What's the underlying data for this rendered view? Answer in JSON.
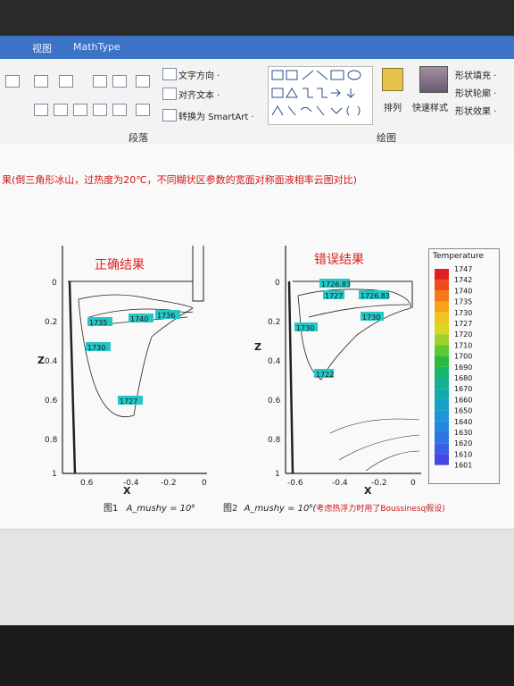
{
  "ribbon": {
    "tabs": [
      "视图",
      "MathType"
    ],
    "paragraph_group_label": "段落",
    "drawing_group_label": "绘图",
    "text_direction": "文字方向 ·",
    "align_text": "对齐文本 ·",
    "convert_smartart": "转换为 SmartArt ·",
    "arrange": "排列",
    "quick_styles": "快速样式",
    "shape_fill": "形状填充 ·",
    "shape_outline": "形状轮廓 ·",
    "shape_effects": "形状效果 ·"
  },
  "document": {
    "caption": "果(倒三角形冰山，过热度为20℃，不同糊状区参数的宽面对称面液相率云图对比)",
    "left_panel": {
      "title": "正确结果",
      "figure_label": "图1",
      "formula": "A_mushy = 10⁶",
      "contour_labels": [
        "1735",
        "1740",
        "1736",
        "1730",
        "1727"
      ]
    },
    "right_panel": {
      "title": "错误结果",
      "figure_label": "图2",
      "formula": "A_mushy = 10⁶(",
      "figure_note": "考虑热浮力时用了Boussinesq假设)",
      "contour_labels": [
        "1726.83",
        "1727",
        "1726.83",
        "1730",
        "1730",
        "1722"
      ]
    },
    "axis": {
      "z_label": "Z",
      "x_label": "X",
      "z_ticks": [
        "0",
        "0.2",
        "0.4",
        "0.6",
        "0.8",
        "1"
      ],
      "x_ticks_left": [
        "0.6",
        "-0.4",
        "-0.2",
        "0"
      ],
      "x_ticks_right": [
        "-0.6",
        "-0.4",
        "-0.2",
        "0"
      ]
    }
  },
  "legend": {
    "title": "Temperature",
    "levels": [
      "1747",
      "1742",
      "1740",
      "1735",
      "1730",
      "1727",
      "1720",
      "1710",
      "1700",
      "1690",
      "1680",
      "1670",
      "1660",
      "1650",
      "1640",
      "1630",
      "1620",
      "1610",
      "1601"
    ],
    "colors": [
      "#e02020",
      "#ee4a1c",
      "#f57a16",
      "#f7a318",
      "#f0c61c",
      "#d8d820",
      "#9fd22a",
      "#5cc832",
      "#26bb3c",
      "#18b46a",
      "#14b090",
      "#14aab0",
      "#16a2c6",
      "#1c96d6",
      "#2486de",
      "#2e74e2",
      "#3a5ee6",
      "#4646e6"
    ]
  }
}
